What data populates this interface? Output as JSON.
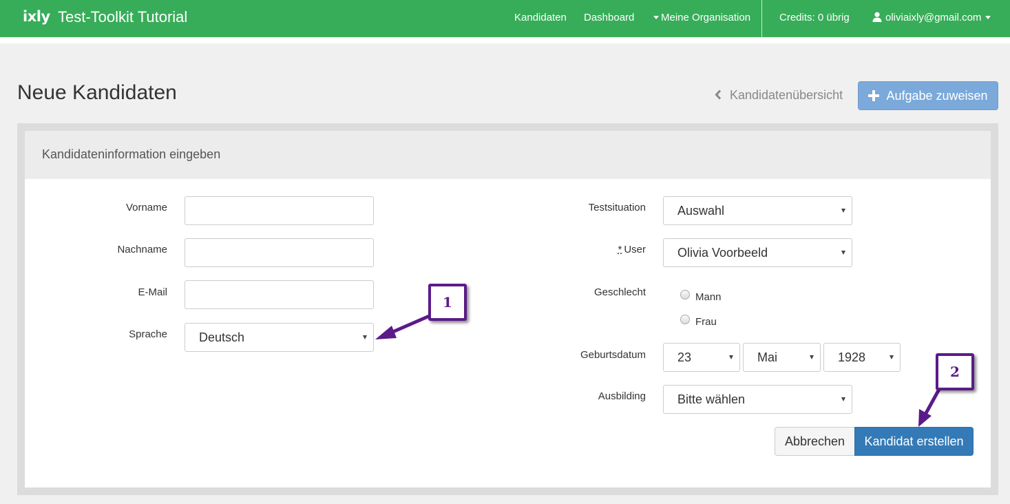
{
  "navbar": {
    "logo": "ixly",
    "title": "Test-Toolkit Tutorial",
    "links": [
      "Kandidaten",
      "Dashboard",
      "Meine Organisation"
    ],
    "credits": "Credits: 0 übrig",
    "user_email": "oliviaixly@gmail.com"
  },
  "page": {
    "title": "Neue Kandidaten",
    "back_link": "Kandidatenübersicht",
    "assign_button": "Aufgabe zuweisen"
  },
  "panel": {
    "heading": "Kandidateninformation eingeben"
  },
  "form": {
    "left": {
      "firstname_label": "Vorname",
      "firstname_value": "",
      "lastname_label": "Nachname",
      "lastname_value": "",
      "email_label": "E-Mail",
      "email_value": "",
      "language_label": "Sprache",
      "language_value": "Deutsch"
    },
    "right": {
      "testsituation_label": "Testsituation",
      "testsituation_value": "Auswahl",
      "user_required_mark": "*",
      "user_label": "User",
      "user_value": "Olivia Voorbeeld",
      "gender_label": "Geschlecht",
      "gender_options": [
        "Mann",
        "Frau"
      ],
      "birthdate_label": "Geburtsdatum",
      "birth_day": "23",
      "birth_month": "Mai",
      "birth_year": "1928",
      "education_label": "Ausbilding",
      "education_value": "Bitte wählen"
    }
  },
  "actions": {
    "cancel": "Abbrechen",
    "create": "Kandidat erstellen"
  },
  "annotations": {
    "callout_1": "1",
    "callout_2": "2"
  },
  "colors": {
    "navbar": "#37ad59",
    "primary_button": "#337ab7",
    "assign_button": "#7ba9d9",
    "annotation": "#5b1a8a"
  }
}
